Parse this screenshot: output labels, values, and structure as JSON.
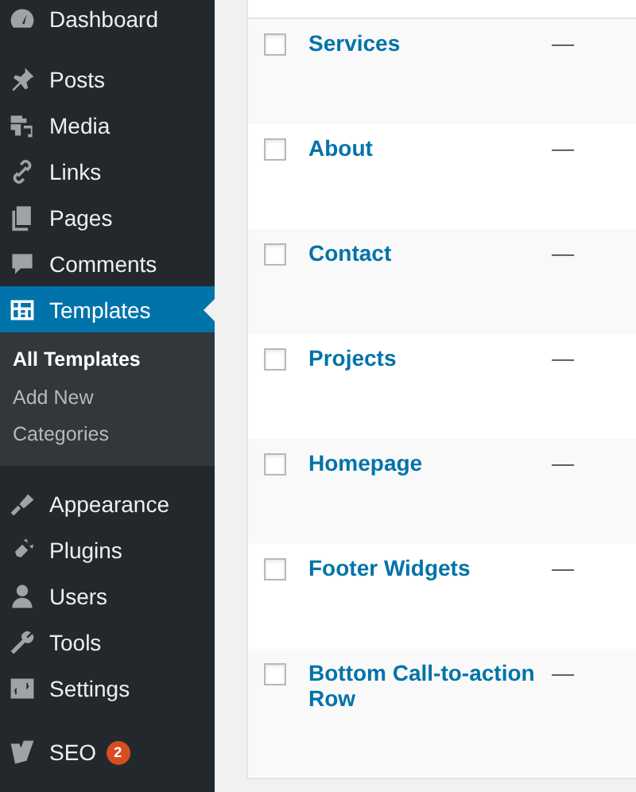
{
  "sidebar": {
    "items": [
      {
        "label": "Dashboard",
        "selected": false
      },
      {
        "label": "Posts",
        "selected": false
      },
      {
        "label": "Media",
        "selected": false
      },
      {
        "label": "Links",
        "selected": false
      },
      {
        "label": "Pages",
        "selected": false
      },
      {
        "label": "Comments",
        "selected": false
      },
      {
        "label": "Templates",
        "selected": true,
        "children": [
          {
            "label": "All Templates",
            "selected": true
          },
          {
            "label": "Add New",
            "selected": false
          },
          {
            "label": "Categories",
            "selected": false
          }
        ]
      },
      {
        "label": "Appearance",
        "selected": false
      },
      {
        "label": "Plugins",
        "selected": false
      },
      {
        "label": "Users",
        "selected": false
      },
      {
        "label": "Tools",
        "selected": false
      },
      {
        "label": "Settings",
        "selected": false
      },
      {
        "label": "SEO",
        "selected": false,
        "badge": "2"
      }
    ]
  },
  "table": {
    "rows": [
      {
        "title": "Services",
        "column_2": "—",
        "checked": false
      },
      {
        "title": "About",
        "column_2": "—",
        "checked": false
      },
      {
        "title": "Contact",
        "column_2": "—",
        "checked": false
      },
      {
        "title": "Projects",
        "column_2": "—",
        "checked": false
      },
      {
        "title": "Homepage",
        "column_2": "—",
        "checked": false
      },
      {
        "title": "Footer Widgets",
        "column_2": "—",
        "checked": false
      },
      {
        "title": "Bottom Call-to-action Row",
        "column_2": "—",
        "checked": false
      }
    ]
  }
}
